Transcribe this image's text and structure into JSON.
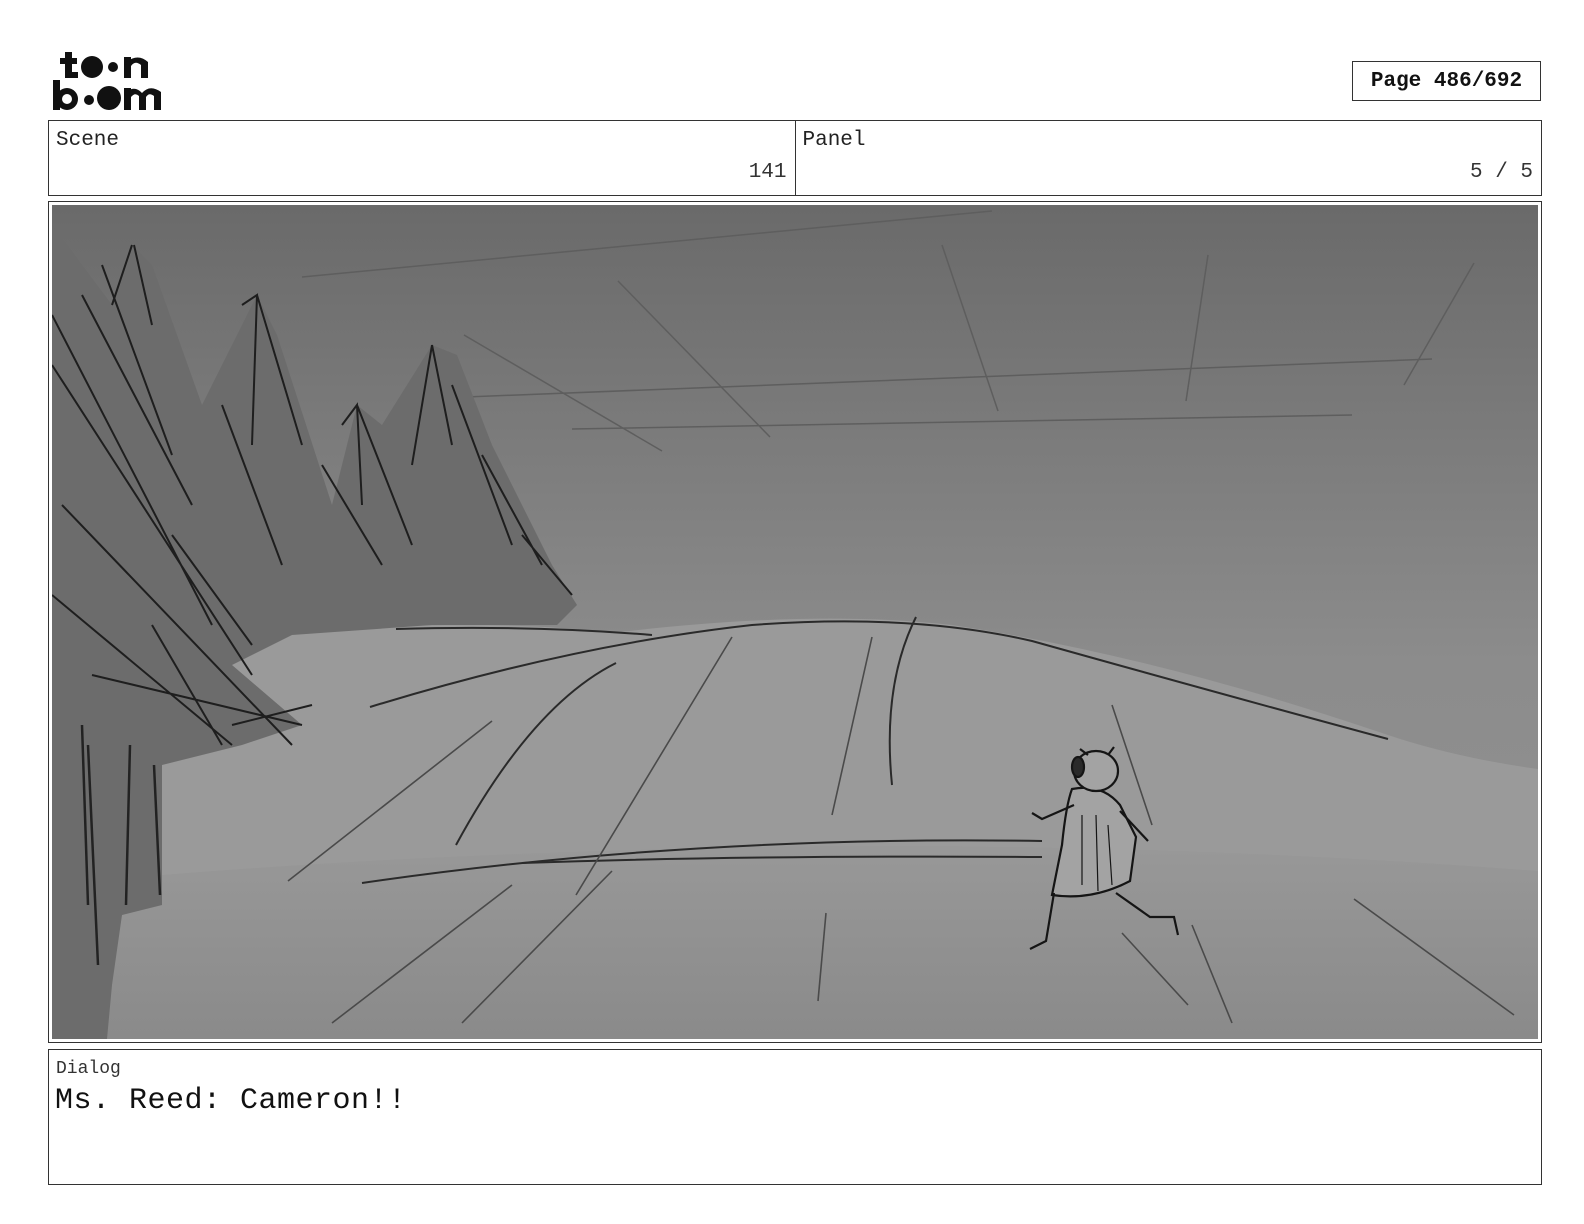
{
  "logo": {
    "icon": "toon-boom-logo",
    "text_line1": "toon",
    "text_line2": "boom"
  },
  "page": {
    "label": "Page 486/692"
  },
  "scene": {
    "label": "Scene",
    "value": "141"
  },
  "panel": {
    "label": "Panel",
    "value": "5 / 5"
  },
  "artwork": {
    "icon": "storyboard-sketch-running-figure-hills-pines"
  },
  "dialog": {
    "label": "Dialog",
    "text": "Ms. Reed: Cameron!!"
  }
}
